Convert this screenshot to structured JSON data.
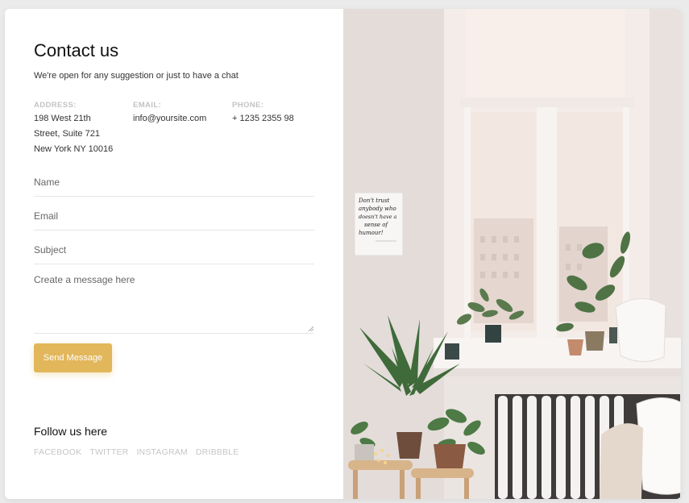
{
  "contact": {
    "title": "Contact us",
    "subtitle": "We're open for any suggestion or just to have a chat",
    "address_label": "ADDRESS:",
    "address_line1": "198 West 21th",
    "address_line2": "Street, Suite 721",
    "address_line3": "New York NY 10016",
    "email_label": "EMAIL:",
    "email_value": "info@yoursite.com",
    "phone_label": "PHONE:",
    "phone_value": "+ 1235 2355 98"
  },
  "form": {
    "name_placeholder": "Name",
    "email_placeholder": "Email",
    "subject_placeholder": "Subject",
    "message_placeholder": "Create a message here",
    "send_label": "Send Message"
  },
  "follow": {
    "title": "Follow us here",
    "links": [
      "FACEBOOK",
      "TWITTER",
      "INSTAGRAM",
      "DRIBBBLE"
    ]
  },
  "poster": {
    "line1": "Don't trust",
    "line2": "anybody who",
    "line3": "doesn't have a",
    "line4": "sense of",
    "line5": "humour!"
  },
  "colors": {
    "accent": "#e2b65a",
    "wall": "#ece6e3",
    "window_light": "#f6ede8"
  }
}
